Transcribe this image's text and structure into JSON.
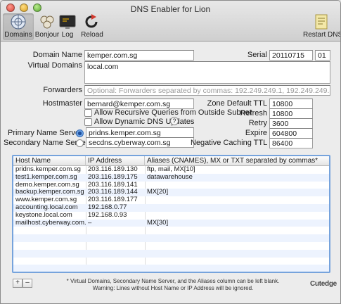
{
  "window": {
    "title": "DNS Enabler for Lion"
  },
  "toolbar": {
    "domains": "Domains",
    "bonjour": "Bonjour",
    "log": "Log",
    "reload": "Reload",
    "restart": "Restart DNS"
  },
  "form": {
    "domain_name_label": "Domain Name",
    "domain_name_value": "kemper.com.sg",
    "serial_label": "Serial",
    "serial_value": "20110715",
    "serial_rev": "01",
    "virtual_domains_label": "Virtual Domains",
    "virtual_domains_value": "local.com",
    "forwarders_label": "Forwarders",
    "forwarders_placeholder": "Optional: Forwarders separated by commas: 192.249.249.1, 192.249.249.3",
    "hostmaster_label": "Hostmaster",
    "hostmaster_value": "bernard@kemper.com.sg",
    "recursive_label": "Allow Recursive Queries from Outside Subnet",
    "dynamic_label": "Allow Dynamic DNS Updates",
    "help_glyph": "?",
    "primary_ns_label": "Primary Name Server",
    "primary_ns_value": "pridns.kemper.com.sg",
    "secondary_ns_label": "Secondary Name Server",
    "secondary_ns_value": "secdns.cyberway.com.sg",
    "default_ttl_label": "Zone Default TTL",
    "default_ttl_value": "10800",
    "refresh_label": "Refresh",
    "refresh_value": "10800",
    "retry_label": "Retry",
    "retry_value": "3600",
    "expire_label": "Expire",
    "expire_value": "604800",
    "neg_ttl_label": "Negative Caching TTL",
    "neg_ttl_value": "86400"
  },
  "table": {
    "headers": [
      "Host Name",
      "IP Address",
      "Aliases (CNAMES), MX or TXT separated by commas*"
    ],
    "rows": [
      [
        "pridns.kemper.com.sg",
        "203.116.189.130",
        "ftp, mail, MX[10]"
      ],
      [
        "test1.kemper.com.sg",
        "203.116.189.175",
        "datawarehouse"
      ],
      [
        "demo.kemper.com.sg",
        "203.116.189.141",
        ""
      ],
      [
        "backup.kemper.com.sg",
        "203.116.189.144",
        "MX[20]"
      ],
      [
        "www.kemper.com.sg",
        "203.116.189.177",
        ""
      ],
      [
        "accounting.local.com",
        "192.168.0.77",
        ""
      ],
      [
        "keystone.local.com",
        "192.168.0.93",
        ""
      ],
      [
        "mailhost.cyberway.com.sg",
        "–",
        "MX[30]"
      ],
      [
        "",
        "",
        ""
      ],
      [
        "",
        "",
        ""
      ],
      [
        "",
        "",
        ""
      ],
      [
        "",
        "",
        ""
      ],
      [
        "",
        "",
        ""
      ],
      [
        "",
        "",
        ""
      ]
    ]
  },
  "footer": {
    "add": "+",
    "remove": "–",
    "note1": "* Virtual Domains, Secondary Name Server, and the Aliases column can be left blank.",
    "note2": "Warning: Lines without Host Name or IP Address will be ignored.",
    "brand": "Cutedge"
  }
}
